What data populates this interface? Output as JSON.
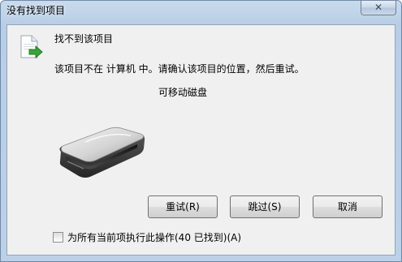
{
  "window": {
    "title": "没有找到项目",
    "close_glyph": "✕"
  },
  "dialog": {
    "heading": "找不到该项目",
    "message": "该项目不在 计算机 中。请确认该项目的位置，然后重试。",
    "item_name": "可移动磁盘",
    "icons": {
      "file": "file-move-icon",
      "drive": "removable-drive-icon",
      "close": "close-icon"
    }
  },
  "buttons": {
    "retry_label": "重试(R)",
    "skip_label": "跳过(S)",
    "cancel_label": "取消"
  },
  "apply_all": {
    "label": "为所有当前项执行此操作(40 已找到)(A)",
    "checked": false
  }
}
